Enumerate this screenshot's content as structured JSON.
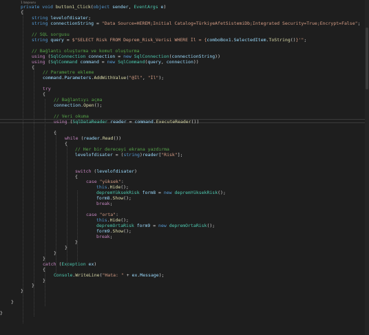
{
  "editor": {
    "codelens": "1 başvuru",
    "colors": {
      "background": "#1e1e1e",
      "keyword": "#569cd6",
      "control": "#c586c0",
      "type": "#4ec9b0",
      "string": "#d69d85",
      "comment": "#57a64a",
      "variable": "#9cdcfe",
      "method": "#dcdcaa",
      "text": "#d4d4d4"
    },
    "lines": [
      {
        "tokens": [
          {
            "t": "kw",
            "v": "private void "
          },
          {
            "t": "mth",
            "v": "button1_Click"
          },
          {
            "t": "plain",
            "v": "("
          },
          {
            "t": "kw",
            "v": "object"
          },
          {
            "t": "var",
            "v": " sender"
          },
          {
            "t": "plain",
            "v": ", "
          },
          {
            "t": "type",
            "v": "EventArgs"
          },
          {
            "t": "var",
            "v": " e"
          },
          {
            "t": "plain",
            "v": ")"
          }
        ]
      },
      {
        "tokens": [
          {
            "t": "plain",
            "v": "{"
          }
        ]
      },
      {
        "tokens": [
          {
            "t": "kw",
            "v": "string "
          },
          {
            "t": "var",
            "v": "levelofdisater"
          },
          {
            "t": "plain",
            "v": ";"
          }
        ]
      },
      {
        "tokens": [
          {
            "t": "kw",
            "v": "string "
          },
          {
            "t": "var",
            "v": "connectionString"
          },
          {
            "t": "plain",
            "v": " = "
          },
          {
            "t": "str",
            "v": "\"Data Source=HEREM;Initial Catalog=TürkiyeAfetSistemiDb;Integrated Security=True;Encrypt=False\""
          },
          {
            "t": "plain",
            "v": ";"
          }
        ]
      },
      {
        "tokens": []
      },
      {
        "tokens": [
          {
            "t": "cmt",
            "v": "// SQL sorgusu"
          }
        ]
      },
      {
        "tokens": [
          {
            "t": "kw",
            "v": "string "
          },
          {
            "t": "var",
            "v": "query"
          },
          {
            "t": "plain",
            "v": " = "
          },
          {
            "t": "str",
            "v": "$\"SELECT Risk FROM Deprem_Risk_Verisi WHERE İl = {"
          },
          {
            "t": "var",
            "v": "comboBox1"
          },
          {
            "t": "plain",
            "v": "."
          },
          {
            "t": "var",
            "v": "SelectedItem"
          },
          {
            "t": "plain",
            "v": "."
          },
          {
            "t": "mth",
            "v": "ToString"
          },
          {
            "t": "plain",
            "v": "()"
          },
          {
            "t": "str",
            "v": "}'\""
          },
          {
            "t": "plain",
            "v": ";"
          }
        ]
      },
      {
        "tokens": []
      },
      {
        "tokens": [
          {
            "t": "cmt",
            "v": "// Bağlantı oluşturma ve komut oluşturma"
          }
        ]
      },
      {
        "tokens": [
          {
            "t": "ctl",
            "v": "using "
          },
          {
            "t": "plain",
            "v": "("
          },
          {
            "t": "type",
            "v": "SqlConnection"
          },
          {
            "t": "var",
            "v": " connection"
          },
          {
            "t": "plain",
            "v": " = "
          },
          {
            "t": "kw",
            "v": "new "
          },
          {
            "t": "type",
            "v": "SqlConnection"
          },
          {
            "t": "plain",
            "v": "("
          },
          {
            "t": "var",
            "v": "connectionString"
          },
          {
            "t": "plain",
            "v": "))"
          }
        ]
      },
      {
        "tokens": [
          {
            "t": "ctl",
            "v": "using "
          },
          {
            "t": "plain",
            "v": "("
          },
          {
            "t": "type",
            "v": "SqlCommand"
          },
          {
            "t": "var",
            "v": " command"
          },
          {
            "t": "plain",
            "v": " = "
          },
          {
            "t": "kw",
            "v": "new "
          },
          {
            "t": "type",
            "v": "SqlCommand"
          },
          {
            "t": "plain",
            "v": "("
          },
          {
            "t": "var",
            "v": "query"
          },
          {
            "t": "plain",
            "v": ", "
          },
          {
            "t": "var",
            "v": "connection"
          },
          {
            "t": "plain",
            "v": "))"
          }
        ]
      },
      {
        "tokens": [
          {
            "t": "plain",
            "v": "{"
          }
        ]
      },
      {
        "tokens": [
          {
            "t": "cmt",
            "v": "// Parametre ekleme"
          }
        ]
      },
      {
        "tokens": [
          {
            "t": "var",
            "v": "command"
          },
          {
            "t": "plain",
            "v": "."
          },
          {
            "t": "var",
            "v": "Parameters"
          },
          {
            "t": "plain",
            "v": "."
          },
          {
            "t": "mth",
            "v": "AddWithValue"
          },
          {
            "t": "plain",
            "v": "("
          },
          {
            "t": "str",
            "v": "\"@İl\""
          },
          {
            "t": "plain",
            "v": ", "
          },
          {
            "t": "str",
            "v": "\"İl\""
          },
          {
            "t": "plain",
            "v": ");"
          }
        ]
      },
      {
        "tokens": []
      },
      {
        "tokens": [
          {
            "t": "ctl",
            "v": "try"
          }
        ]
      },
      {
        "tokens": [
          {
            "t": "plain",
            "v": "{"
          }
        ]
      },
      {
        "tokens": [
          {
            "t": "cmt",
            "v": "// Bağlantıyı açma"
          }
        ]
      },
      {
        "tokens": [
          {
            "t": "var",
            "v": "connection"
          },
          {
            "t": "plain",
            "v": "."
          },
          {
            "t": "mth",
            "v": "Open"
          },
          {
            "t": "plain",
            "v": "();"
          }
        ]
      },
      {
        "tokens": []
      },
      {
        "tokens": [
          {
            "t": "cmt",
            "v": "// Veri okuma"
          }
        ]
      },
      {
        "tokens": [
          {
            "t": "ctl",
            "v": "using "
          },
          {
            "t": "plain",
            "v": "("
          },
          {
            "t": "type",
            "v": "SqlDataReader"
          },
          {
            "t": "var",
            "v": " reader"
          },
          {
            "t": "plain",
            "v": " = "
          },
          {
            "t": "var",
            "v": "command"
          },
          {
            "t": "plain",
            "v": "."
          },
          {
            "t": "mth",
            "v": "ExecuteReader"
          },
          {
            "t": "plain",
            "v": "())"
          }
        ]
      },
      {
        "tokens": []
      },
      {
        "tokens": [
          {
            "t": "plain",
            "v": "{"
          }
        ]
      },
      {
        "tokens": [
          {
            "t": "ctl",
            "v": "while "
          },
          {
            "t": "plain",
            "v": "("
          },
          {
            "t": "var",
            "v": "reader"
          },
          {
            "t": "plain",
            "v": "."
          },
          {
            "t": "mth",
            "v": "Read"
          },
          {
            "t": "plain",
            "v": "())"
          }
        ]
      },
      {
        "tokens": [
          {
            "t": "plain",
            "v": "{"
          }
        ]
      },
      {
        "tokens": [
          {
            "t": "cmt",
            "v": "// Her bir dereceyi ekrana yazdırma"
          }
        ]
      },
      {
        "tokens": [
          {
            "t": "var",
            "v": "levelofdisater"
          },
          {
            "t": "plain",
            "v": " = ("
          },
          {
            "t": "kw",
            "v": "string"
          },
          {
            "t": "plain",
            "v": ")"
          },
          {
            "t": "var",
            "v": "reader"
          },
          {
            "t": "plain",
            "v": "["
          },
          {
            "t": "str",
            "v": "\"Risk\""
          },
          {
            "t": "plain",
            "v": "];"
          }
        ]
      },
      {
        "tokens": []
      },
      {
        "tokens": []
      },
      {
        "tokens": [
          {
            "t": "ctl",
            "v": "switch "
          },
          {
            "t": "plain",
            "v": "("
          },
          {
            "t": "var",
            "v": "levelofdisater"
          },
          {
            "t": "plain",
            "v": ")"
          }
        ]
      },
      {
        "tokens": [
          {
            "t": "plain",
            "v": "{"
          }
        ]
      },
      {
        "tokens": [
          {
            "t": "ctl",
            "v": "case "
          },
          {
            "t": "str",
            "v": "\"yüksek\""
          },
          {
            "t": "plain",
            "v": ":"
          }
        ]
      },
      {
        "tokens": [
          {
            "t": "kw",
            "v": "this"
          },
          {
            "t": "plain",
            "v": "."
          },
          {
            "t": "mth",
            "v": "Hide"
          },
          {
            "t": "plain",
            "v": "();"
          }
        ]
      },
      {
        "tokens": [
          {
            "t": "type",
            "v": "depremYüksekRisk"
          },
          {
            "t": "var",
            "v": " form8"
          },
          {
            "t": "plain",
            "v": " = "
          },
          {
            "t": "kw",
            "v": "new "
          },
          {
            "t": "type",
            "v": "depremYüksekRisk"
          },
          {
            "t": "plain",
            "v": "();"
          }
        ]
      },
      {
        "tokens": [
          {
            "t": "var",
            "v": "form8"
          },
          {
            "t": "plain",
            "v": "."
          },
          {
            "t": "mth",
            "v": "Show"
          },
          {
            "t": "plain",
            "v": "();"
          }
        ]
      },
      {
        "tokens": [
          {
            "t": "ctl",
            "v": "break"
          },
          {
            "t": "plain",
            "v": ";"
          }
        ]
      },
      {
        "tokens": []
      },
      {
        "tokens": [
          {
            "t": "ctl",
            "v": "case "
          },
          {
            "t": "str",
            "v": "\"orta\""
          },
          {
            "t": "plain",
            "v": ":"
          }
        ]
      },
      {
        "tokens": [
          {
            "t": "kw",
            "v": "this"
          },
          {
            "t": "plain",
            "v": "."
          },
          {
            "t": "mth",
            "v": "Hide"
          },
          {
            "t": "plain",
            "v": "();"
          }
        ]
      },
      {
        "tokens": [
          {
            "t": "type",
            "v": "depremOrtaRisk"
          },
          {
            "t": "var",
            "v": " form9"
          },
          {
            "t": "plain",
            "v": " = "
          },
          {
            "t": "kw",
            "v": "new "
          },
          {
            "t": "type",
            "v": "depremOrtaRisk"
          },
          {
            "t": "plain",
            "v": "();"
          }
        ]
      },
      {
        "tokens": [
          {
            "t": "var",
            "v": "form9"
          },
          {
            "t": "plain",
            "v": "."
          },
          {
            "t": "mth",
            "v": "Show"
          },
          {
            "t": "plain",
            "v": "();"
          }
        ]
      },
      {
        "tokens": [
          {
            "t": "ctl",
            "v": "break"
          },
          {
            "t": "plain",
            "v": ";"
          }
        ]
      },
      {
        "tokens": [
          {
            "t": "plain",
            "v": "}"
          }
        ]
      },
      {
        "tokens": [
          {
            "t": "plain",
            "v": "}"
          }
        ]
      },
      {
        "tokens": [
          {
            "t": "plain",
            "v": "}"
          }
        ]
      },
      {
        "tokens": [
          {
            "t": "plain",
            "v": "}"
          }
        ]
      },
      {
        "tokens": [
          {
            "t": "ctl",
            "v": "catch "
          },
          {
            "t": "plain",
            "v": "("
          },
          {
            "t": "type",
            "v": "Exception"
          },
          {
            "t": "var",
            "v": " ex"
          },
          {
            "t": "plain",
            "v": ")"
          }
        ]
      },
      {
        "tokens": [
          {
            "t": "plain",
            "v": "{"
          }
        ]
      },
      {
        "tokens": [
          {
            "t": "type",
            "v": "Console"
          },
          {
            "t": "plain",
            "v": "."
          },
          {
            "t": "mth",
            "v": "WriteLine"
          },
          {
            "t": "plain",
            "v": "("
          },
          {
            "t": "str",
            "v": "\"Hata: \""
          },
          {
            "t": "plain",
            "v": " + "
          },
          {
            "t": "var",
            "v": "ex"
          },
          {
            "t": "plain",
            "v": "."
          },
          {
            "t": "var",
            "v": "Message"
          },
          {
            "t": "plain",
            "v": ");"
          }
        ]
      },
      {
        "tokens": [
          {
            "t": "plain",
            "v": "}"
          }
        ]
      },
      {
        "tokens": [
          {
            "t": "plain",
            "v": "}"
          }
        ]
      },
      {
        "tokens": [
          {
            "t": "plain",
            "v": "}"
          }
        ]
      },
      {
        "tokens": []
      },
      {
        "tokens": [
          {
            "t": "plain",
            "v": "}"
          }
        ]
      },
      {
        "tokens": []
      },
      {
        "tokens": [
          {
            "t": "plain",
            "v": "}"
          }
        ]
      }
    ]
  }
}
